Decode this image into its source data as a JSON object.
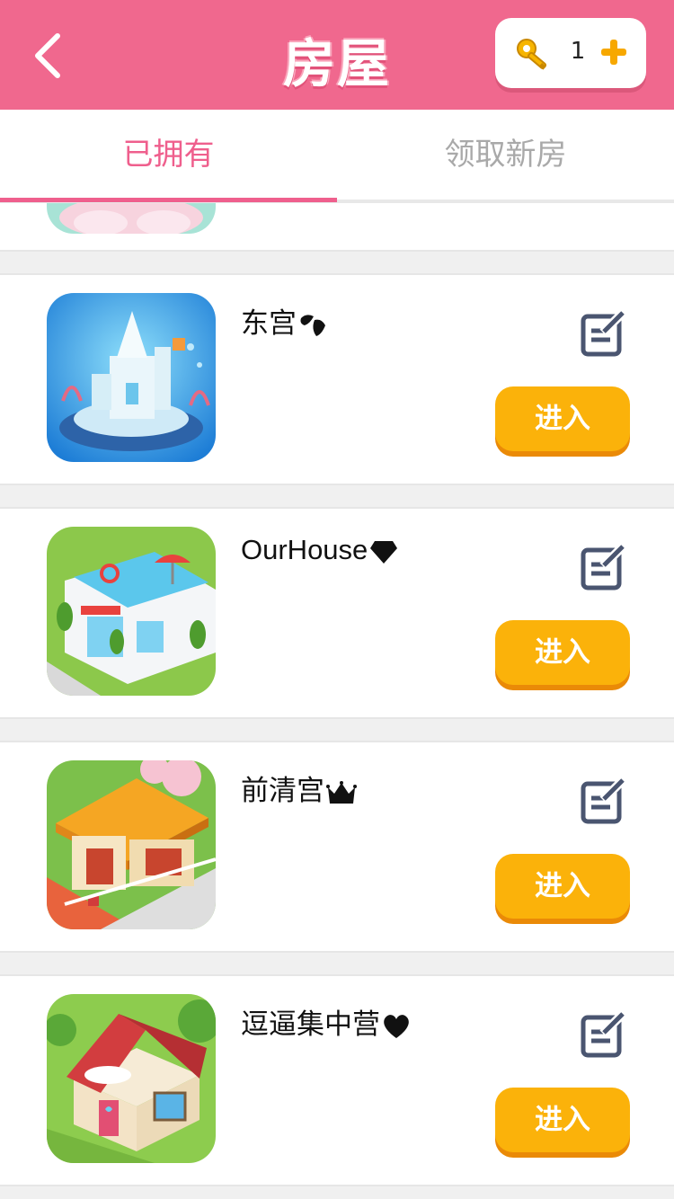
{
  "header": {
    "title": "房屋",
    "back_icon": "chevron-left-icon",
    "keys": {
      "icon": "key-icon",
      "count": "1",
      "add_icon": "plus-icon"
    }
  },
  "tabs": [
    {
      "label": "已拥有",
      "active": true
    },
    {
      "label": "领取新房",
      "active": false
    }
  ],
  "houses": [
    {
      "name": "东宫",
      "badge_icon": "petal-icon",
      "enter_label": "进入",
      "edit_icon": "edit-icon",
      "thumbnail": "sea-palace-bubble"
    },
    {
      "name": "OurHouse",
      "badge_icon": "diamond-icon",
      "enter_label": "进入",
      "edit_icon": "edit-icon",
      "thumbnail": "pool-villa"
    },
    {
      "name": "前清宫",
      "badge_icon": "crown-icon",
      "enter_label": "进入",
      "edit_icon": "edit-icon",
      "thumbnail": "chinese-pavilion"
    },
    {
      "name": "逗逼集中营",
      "badge_icon": "heart-icon",
      "enter_label": "进入",
      "edit_icon": "edit-icon",
      "thumbnail": "love-cottage"
    }
  ],
  "colors": {
    "header": "#f0688e",
    "accent": "#ef5f8d",
    "button": "#fbb20a",
    "inactive_tab": "#a9a9a9"
  }
}
